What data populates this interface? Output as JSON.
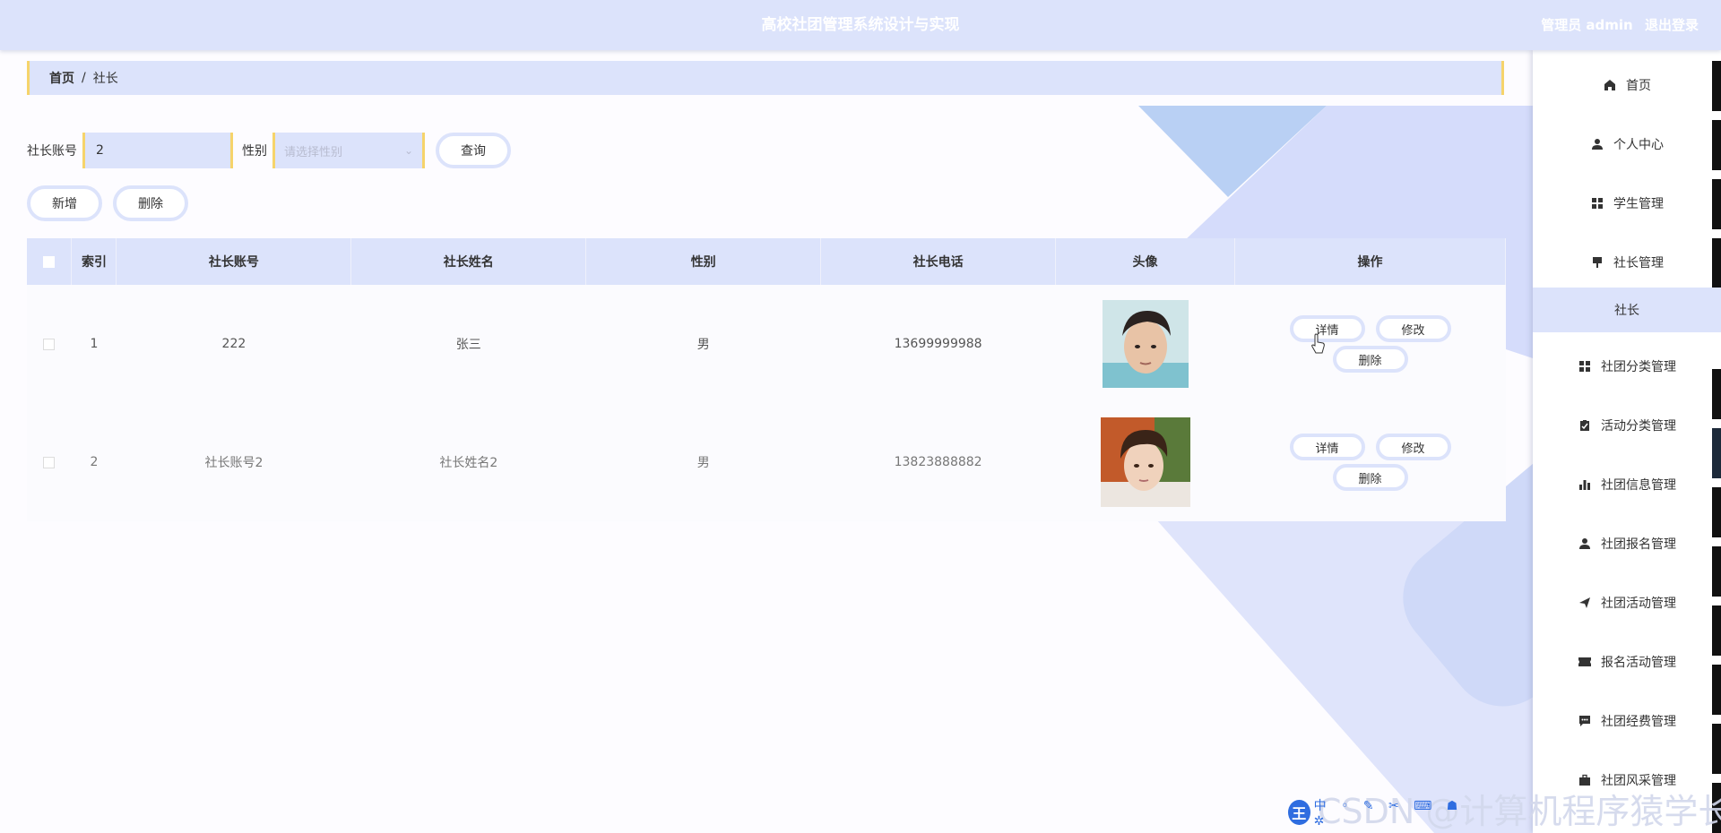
{
  "header": {
    "title": "高校社团管理系统设计与实现",
    "user_label": "管理员 admin",
    "logout_label": "退出登录"
  },
  "breadcrumb": {
    "home": "首页",
    "separator": "/",
    "current": "社长"
  },
  "search": {
    "account_label": "社长账号",
    "account_value": "2",
    "gender_label": "性别",
    "gender_placeholder": "请选择性别",
    "query_label": "查询"
  },
  "actions": {
    "add_label": "新增",
    "delete_label": "删除"
  },
  "table": {
    "columns": [
      "索引",
      "社长账号",
      "社长姓名",
      "性别",
      "社长电话",
      "头像",
      "操作"
    ],
    "rows": [
      {
        "index": "1",
        "account": "222",
        "name": "张三",
        "gender": "男",
        "phone": "13699999988"
      },
      {
        "index": "2",
        "account": "社长账号2",
        "name": "社长姓名2",
        "gender": "男",
        "phone": "13823888882"
      }
    ],
    "op_detail": "详情",
    "op_edit": "修改",
    "op_delete": "删除"
  },
  "sidebar": {
    "items": [
      {
        "label": "首页",
        "icon": "home-icon"
      },
      {
        "label": "个人中心",
        "icon": "person-icon"
      },
      {
        "label": "学生管理",
        "icon": "grid-icon"
      },
      {
        "label": "社长管理",
        "icon": "pin-icon"
      },
      {
        "label": "社长",
        "icon": ""
      },
      {
        "label": "社团分类管理",
        "icon": "grid-icon"
      },
      {
        "label": "活动分类管理",
        "icon": "clipboard-icon"
      },
      {
        "label": "社团信息管理",
        "icon": "bar-chart-icon"
      },
      {
        "label": "社团报名管理",
        "icon": "person-icon"
      },
      {
        "label": "社团活动管理",
        "icon": "send-icon"
      },
      {
        "label": "报名活动管理",
        "icon": "ticket-icon"
      },
      {
        "label": "社团经费管理",
        "icon": "chat-icon"
      },
      {
        "label": "社团风采管理",
        "icon": "briefcase-icon"
      }
    ]
  },
  "watermark": "CSDN @计算机程序猿学长",
  "ime": {
    "logo": "王",
    "tools": "中 ◦ ✎ ✂ ⌨ ☗ ✲"
  },
  "colors": {
    "accent": "#dce3fb",
    "border_accent": "#f6d46b"
  }
}
